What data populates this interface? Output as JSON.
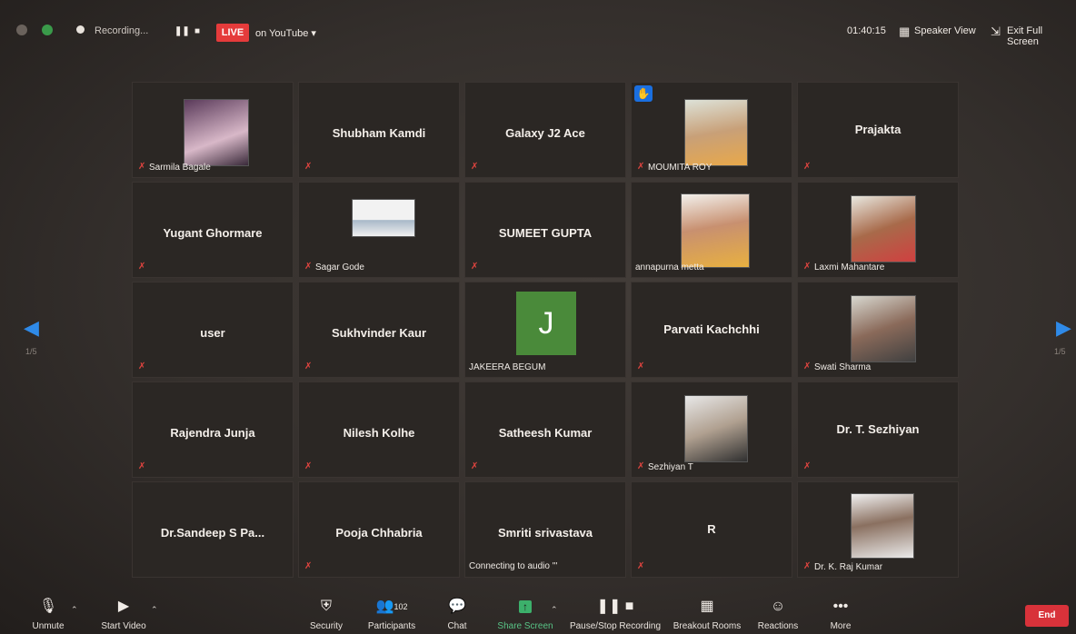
{
  "topbar": {
    "recording_label": "Recording...",
    "live_label": "LIVE",
    "youtube_label": "on YouTube",
    "timer": "01:40:15",
    "speaker_view": "Speaker View",
    "exit_full_screen": "Exit Full Screen"
  },
  "tiles": [
    {
      "name": "",
      "caption": "Sarmila Bagale",
      "photo": true
    },
    {
      "name": "Shubham Kamdi",
      "caption": ""
    },
    {
      "name": "Galaxy J2 Ace",
      "caption": ""
    },
    {
      "name": "",
      "caption": "MOUMITA ROY",
      "photo": true,
      "hand": true
    },
    {
      "name": "Prajakta",
      "caption": ""
    },
    {
      "name": "Yugant Ghormare",
      "caption": ""
    },
    {
      "name": "",
      "caption": "Sagar Gode",
      "photo": true
    },
    {
      "name": "SUMEET GUPTA",
      "caption": ""
    },
    {
      "name": "",
      "caption": "annapurna metta",
      "photo": true
    },
    {
      "name": "",
      "caption": "Laxmi Mahantare",
      "photo": true
    },
    {
      "name": "user",
      "caption": ""
    },
    {
      "name": "Sukhvinder Kaur",
      "caption": ""
    },
    {
      "name": "",
      "caption": "JAKEERA BEGUM",
      "avatar": "J"
    },
    {
      "name": "Parvati Kachchhi",
      "caption": ""
    },
    {
      "name": "",
      "caption": "Swati Sharma",
      "photo": true
    },
    {
      "name": "Rajendra Junja",
      "caption": ""
    },
    {
      "name": "Nilesh Kolhe",
      "caption": ""
    },
    {
      "name": "Satheesh Kumar",
      "caption": ""
    },
    {
      "name": "",
      "caption": "Sezhiyan T",
      "photo": true
    },
    {
      "name": "Dr. T. Sezhiyan",
      "caption": ""
    },
    {
      "name": "Dr.Sandeep S Pa...",
      "caption": ""
    },
    {
      "name": "Pooja Chhabria",
      "caption": ""
    },
    {
      "name": "Smriti srivastava",
      "caption": "",
      "connecting": "Connecting to audio '''"
    },
    {
      "name": "R",
      "caption": ""
    },
    {
      "name": "",
      "caption": "Dr. K. Raj Kumar",
      "photo": true
    }
  ],
  "bottombar": {
    "unmute": "Unmute",
    "start_video": "Start Video",
    "security": "Security",
    "participants": "Participants",
    "participants_count": "102",
    "chat": "Chat",
    "share_screen": "Share Screen",
    "pause_stop_recording": "Pause/Stop Recording",
    "breakout_rooms": "Breakout Rooms",
    "reactions": "Reactions",
    "more": "More",
    "end": "End"
  },
  "colors": {
    "live": "#e53b3b",
    "end": "#d8323a",
    "share_green": "#3cb06b",
    "avatar_green": "#4a8a3a",
    "hand_blue": "#1a6fe0",
    "nav_arrow": "#2f8ae8"
  }
}
